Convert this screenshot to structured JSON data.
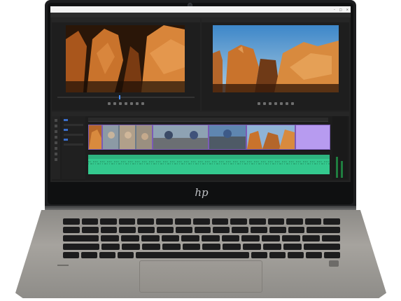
{
  "device": {
    "brand_logo": "hp"
  },
  "window": {
    "title": "",
    "controls": [
      "minimize-icon",
      "maximize-icon",
      "close-icon"
    ]
  },
  "panels": {
    "source_monitor": {
      "playhead_fraction": 0.45
    },
    "program_monitor": {}
  },
  "colors": {
    "audio_track": "#34c98e",
    "clip_border": "#7b5bb6",
    "accent": "#4a8ef5",
    "lavender_clip": "#b79bf0"
  }
}
